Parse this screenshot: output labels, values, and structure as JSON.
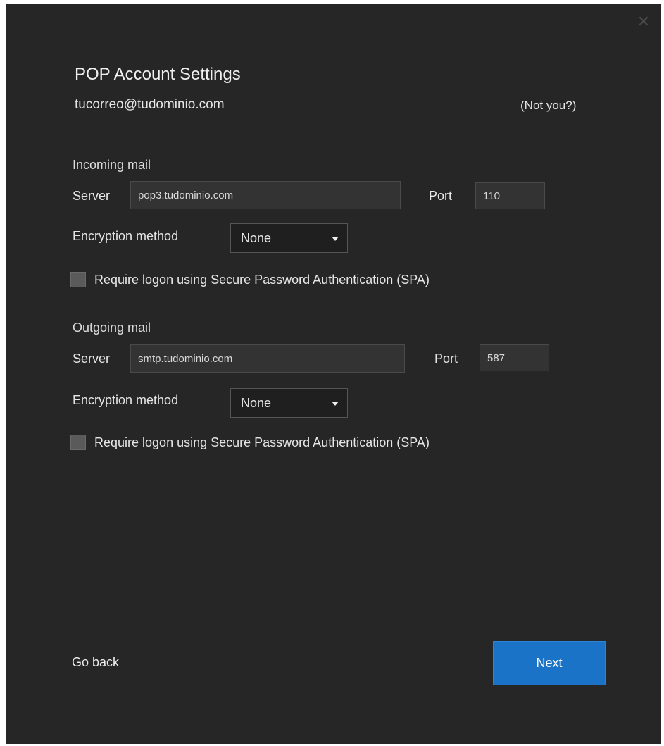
{
  "dialog": {
    "close_glyph": "✕",
    "title": "POP Account Settings",
    "email": "tucorreo@tudominio.com",
    "not_you": "(Not you?)"
  },
  "incoming": {
    "section_label": "Incoming mail",
    "server_label": "Server",
    "server_value": "pop3.tudominio.com",
    "port_label": "Port",
    "port_value": "110",
    "encryption_label": "Encryption method",
    "encryption_value": "None",
    "spa_label": "Require logon using Secure Password Authentication (SPA)",
    "spa_checked": false
  },
  "outgoing": {
    "section_label": "Outgoing mail",
    "server_label": "Server",
    "server_value": "smtp.tudominio.com",
    "port_label": "Port",
    "port_value": "587",
    "encryption_label": "Encryption method",
    "encryption_value": "None",
    "spa_label": "Require logon using Secure Password Authentication (SPA)",
    "spa_checked": false
  },
  "footer": {
    "go_back": "Go back",
    "next": "Next"
  },
  "colors": {
    "background": "#262626",
    "accent": "#1a73c6"
  },
  "icons": {
    "close": "close-icon",
    "dropdown": "chevron-down-icon"
  }
}
